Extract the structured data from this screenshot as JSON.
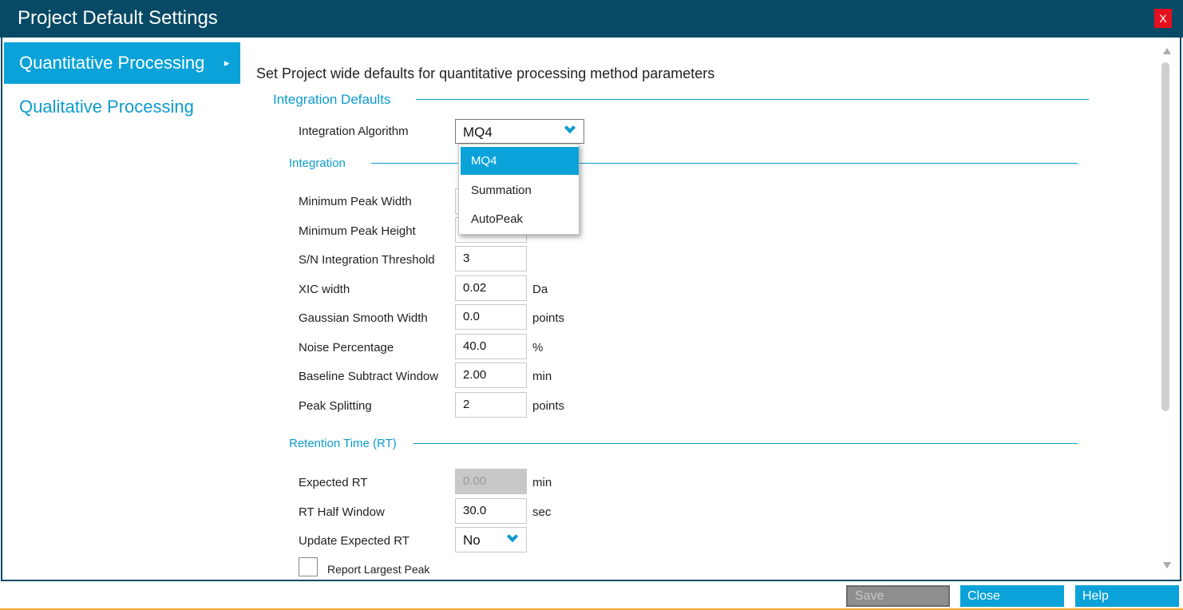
{
  "window": {
    "title": "Project Default Settings",
    "close_label": "X"
  },
  "nav": {
    "items": [
      {
        "label": "Quantitative Processing",
        "active": true,
        "arrow": "▸"
      },
      {
        "label": "Qualitative Processing",
        "active": false
      }
    ]
  },
  "intro": "Set Project wide defaults for quantitative processing method parameters",
  "integration_defaults": {
    "heading": "Integration Defaults",
    "algorithm_label": "Integration Algorithm",
    "algorithm_value": "MQ4",
    "dropdown_options": [
      "MQ4",
      "Summation",
      "AutoPeak"
    ],
    "dropdown_selected": "MQ4"
  },
  "integration": {
    "heading": "Integration",
    "rows": [
      {
        "label": "Minimum Peak Width",
        "value": "",
        "unit": ""
      },
      {
        "label": "Minimum Peak Height",
        "value": "",
        "unit": ""
      },
      {
        "label": "S/N Integration Threshold",
        "value": "3",
        "unit": ""
      },
      {
        "label": "XIC width",
        "value": "0.02",
        "unit": "Da"
      },
      {
        "label": "Gaussian Smooth Width",
        "value": "0.0",
        "unit": "points"
      },
      {
        "label": "Noise Percentage",
        "value": "40.0",
        "unit": "%"
      },
      {
        "label": "Baseline Subtract Window",
        "value": "2.00",
        "unit": "min"
      },
      {
        "label": "Peak Splitting",
        "value": "2",
        "unit": "points"
      }
    ]
  },
  "retention_time": {
    "heading": "Retention Time (RT)",
    "expected_rt": {
      "label": "Expected RT",
      "value": "0.00",
      "unit": "min",
      "disabled": true
    },
    "rt_half_window": {
      "label": "RT Half Window",
      "value": "30.0",
      "unit": "sec"
    },
    "update_expected_rt": {
      "label": "Update Expected RT",
      "value": "No"
    },
    "report_largest_peak": {
      "label": "Report Largest Peak",
      "checked": false
    }
  },
  "buttons": {
    "save": "Save",
    "close": "Close",
    "help": "Help"
  },
  "colors": {
    "titlebar": "#084a66",
    "accent": "#0aa2d8",
    "close_red": "#e3101f"
  }
}
